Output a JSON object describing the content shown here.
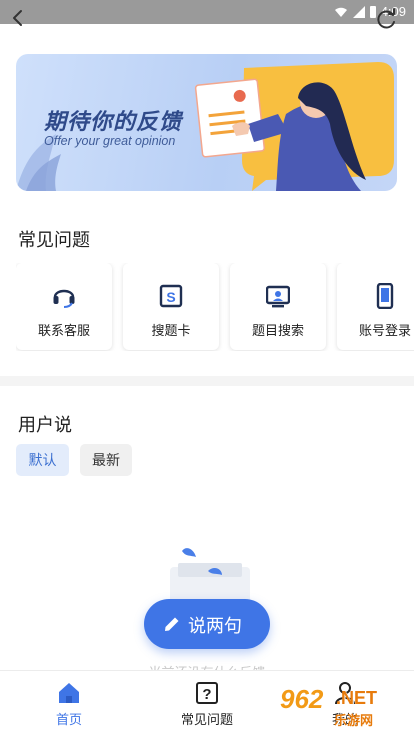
{
  "status_bar": {
    "time": "4:09"
  },
  "banner": {
    "title": "期待你的反馈",
    "subtitle": "Offer your great opinion"
  },
  "faq": {
    "title": "常见问题",
    "items": [
      {
        "label": "联系客服",
        "icon": "headset-icon"
      },
      {
        "label": "搜题卡",
        "icon": "search-card-icon"
      },
      {
        "label": "题目搜索",
        "icon": "screen-search-icon"
      },
      {
        "label": "账号登录",
        "icon": "phone-icon"
      }
    ]
  },
  "user_says": {
    "title": "用户说",
    "filters": [
      {
        "label": "默认",
        "selected": true
      },
      {
        "label": "最新",
        "selected": false
      }
    ],
    "empty_text": "当前还没有什么反馈"
  },
  "fab": {
    "label": "说两句",
    "icon": "pencil-icon"
  },
  "tabbar": {
    "items": [
      {
        "label": "首页",
        "icon": "home-icon",
        "active": true
      },
      {
        "label": "常见问题",
        "icon": "question-icon",
        "active": false
      },
      {
        "label": "我的",
        "icon": "person-icon",
        "active": false
      }
    ]
  },
  "watermark": {
    "number": "962",
    "net": ".NET",
    "site": "乐游网"
  },
  "colors": {
    "accent": "#3f75e6",
    "chip_selected_bg": "#e3ecfb",
    "banner_bg": "#c4d6f7",
    "watermark": "#f29a16"
  }
}
